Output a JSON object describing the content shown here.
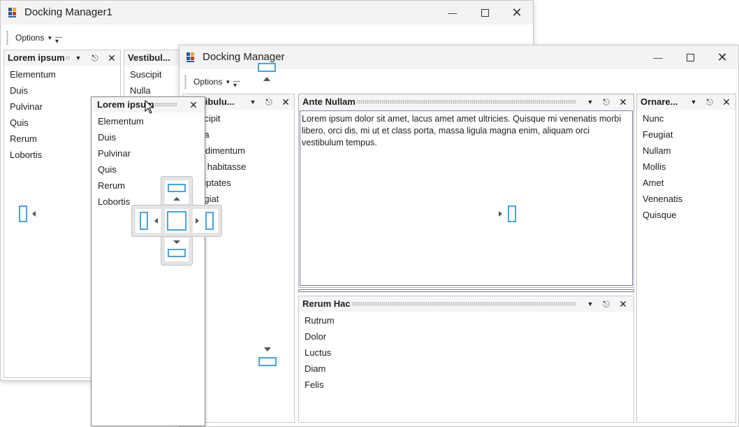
{
  "back_window": {
    "title": "Docking Manager1",
    "toolbar": {
      "options_label": "Options"
    },
    "pane_left": {
      "title": "Lorem ipsum",
      "items": [
        "Elementum",
        "Duis",
        "Pulvinar",
        "Quis",
        "Rerum",
        "Lobortis"
      ]
    },
    "pane_vestibulum": {
      "title": "Vestibul...",
      "items": [
        "Suscipit",
        "Nulla"
      ]
    }
  },
  "floating_pane": {
    "title": "Lorem ipsum",
    "items": [
      "Elementum",
      "Duis",
      "Pulvinar",
      "Quis",
      "Rerum",
      "Lobortis"
    ]
  },
  "front_window": {
    "title": "Docking Manager",
    "toolbar": {
      "options_label": "Options"
    },
    "pane_vestibulum": {
      "title": "Vestibulu...",
      "items": [
        "Suscipit",
        "Nulla",
        "Condimentum",
        "Hac habitasse",
        "Voluptates",
        "Feugiat"
      ]
    },
    "pane_ante": {
      "title": "Ante Nullam",
      "text": "Lorem ipsum dolor sit amet, lacus amet amet ultricies. Quisque mi venenatis morbi libero, orci dis, mi ut et class porta, massa ligula magna enim, aliquam orci vestibulum tempus."
    },
    "pane_rerum": {
      "title": "Rerum Hac",
      "items": [
        "Rutrum",
        "Dolor",
        "Luctus",
        "Diam",
        "Felis"
      ]
    },
    "pane_ornare": {
      "title": "Ornare...",
      "items": [
        "Nunc",
        "Feugiat",
        "Nullam",
        "Mollis",
        "Amet",
        "Venenatis",
        "Quisque"
      ]
    }
  },
  "icons": {
    "app": "app-grid-icon",
    "minimize": "minimize-icon",
    "maximize": "maximize-icon",
    "close": "close-icon",
    "pin": "pin-icon",
    "dropdown": "chevron-down-icon",
    "dock_guide": "dock-guide-icon"
  },
  "colors": {
    "accent": "#4aa3df",
    "active_border": "#7a7a9a"
  }
}
